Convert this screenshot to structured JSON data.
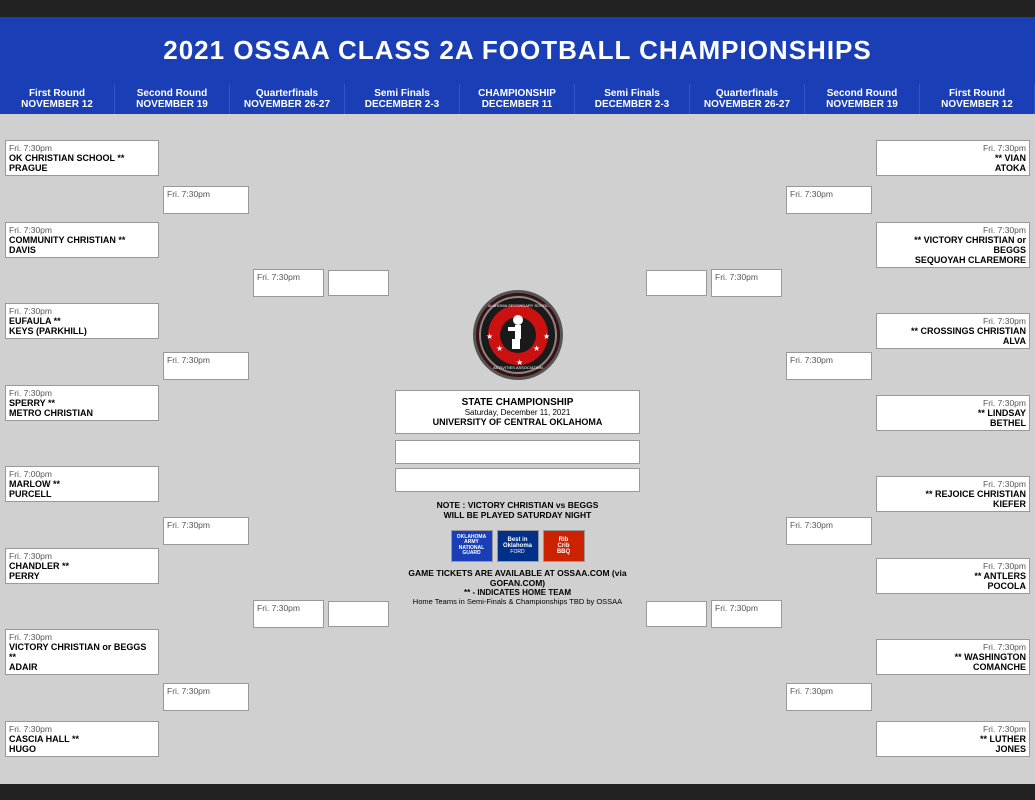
{
  "title": "2021 OSSAA CLASS 2A FOOTBALL CHAMPIONSHIPS",
  "rounds": [
    {
      "name": "First Round",
      "date": "NOVEMBER 12"
    },
    {
      "name": "Second Round",
      "date": "NOVEMBER 19"
    },
    {
      "name": "Quarterfinals",
      "date": "NOVEMBER 26-27"
    },
    {
      "name": "Semi Finals",
      "date": "DECEMBER 2-3"
    },
    {
      "name": "CHAMPIONSHIP",
      "date": "DECEMBER 11"
    },
    {
      "name": "Semi Finals",
      "date": "DECEMBER 2-3"
    },
    {
      "name": "Quarterfinals",
      "date": "NOVEMBER 26-27"
    },
    {
      "name": "Second Round",
      "date": "NOVEMBER 19"
    },
    {
      "name": "First Round",
      "date": "NOVEMBER 12"
    }
  ],
  "left_r1": [
    {
      "time": "Fri. 7:30pm",
      "team1": "OK CHRISTIAN SCHOOL **",
      "team2": "PRAGUE"
    },
    {
      "time": "Fri. 7:30pm",
      "team1": "COMMUNITY CHRISTIAN **",
      "team2": "DAVIS"
    },
    {
      "time": "Fri. 7:30pm",
      "team1": "EUFAULA **",
      "team2": "KEYS (PARKHILL)"
    },
    {
      "time": "Fri. 7:30pm",
      "team1": "SPERRY **",
      "team2": "METRO CHRISTIAN"
    },
    {
      "time": "Fri. 7:00pm",
      "team1": "MARLOW **",
      "team2": "PURCELL"
    },
    {
      "time": "Fri. 7:30pm",
      "team1": "CHANDLER **",
      "team2": "PERRY"
    },
    {
      "time": "Fri. 7:30pm",
      "team1": "VICTORY CHRISTIAN or BEGGS **",
      "team2": "ADAIR"
    },
    {
      "time": "Fri. 7:30pm",
      "team1": "CASCIA HALL **",
      "team2": "HUGO"
    }
  ],
  "left_r2_time": "Fri. 7:30pm",
  "left_r3_time": "Fri. 7:30pm",
  "left_r4_time": "",
  "right_r1": [
    {
      "time": "Fri. 7:30pm",
      "team1": "** VIAN",
      "team2": "ATOKA"
    },
    {
      "time": "Fri. 7:30pm",
      "team1": "** VICTORY CHRISTIAN or BEGGS",
      "team2": "SEQUOYAH CLAREMORE"
    },
    {
      "time": "Fri. 7:30pm",
      "team1": "** CROSSINGS CHRISTIAN",
      "team2": "ALVA"
    },
    {
      "time": "Fri. 7:30pm",
      "team1": "** LINDSAY",
      "team2": "BETHEL"
    },
    {
      "time": "Fri. 7:30pm",
      "team1": "** REJOICE CHRISTIAN",
      "team2": "KIEFER"
    },
    {
      "time": "Fri. 7:30pm",
      "team1": "** ANTLERS",
      "team2": "POCOLA"
    },
    {
      "time": "Fri. 7:30pm",
      "team1": "** WASHINGTON",
      "team2": "COMANCHE"
    },
    {
      "time": "Fri. 7:30pm",
      "team1": "** LUTHER",
      "team2": "JONES"
    }
  ],
  "right_r2_time": "Fri. 7:30pm",
  "right_r3_time": "Fri. 7:30pm",
  "championship": {
    "label": "STATE CHAMPIONSHIP",
    "date": "Saturday, December 11, 2021",
    "venue": "UNIVERSITY OF CENTRAL OKLAHOMA"
  },
  "note": {
    "line1": "NOTE : VICTORY CHRISTIAN vs BEGGS",
    "line2": "WILL BE PLAYED SATURDAY NIGHT"
  },
  "footer": {
    "line1": "GAME TICKETS ARE AVAILABLE AT OSSAA.COM (via GOFAN.COM)",
    "line2": "** - INDICATES HOME TEAM",
    "line3": "Home Teams in Semi-Finals & Championships TBD by OSSAA"
  }
}
